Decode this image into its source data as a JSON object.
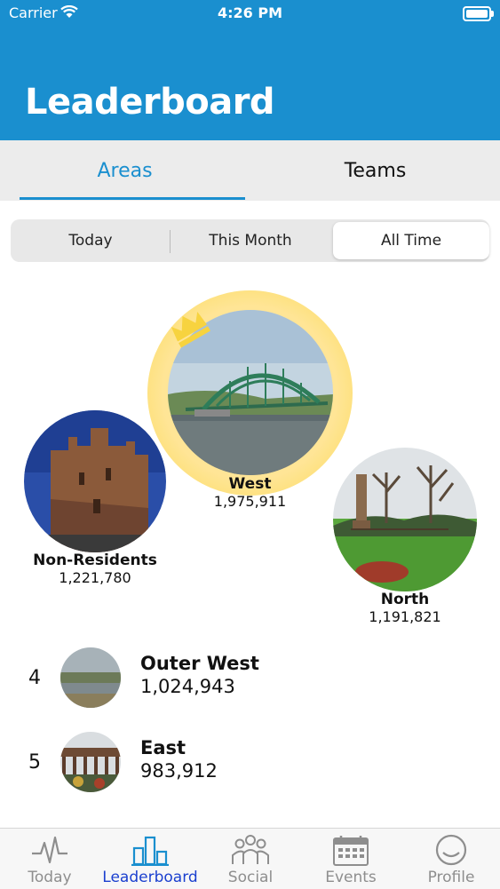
{
  "status_bar": {
    "carrier": "Carrier",
    "time": "4:26 PM"
  },
  "header": {
    "title": "Leaderboard"
  },
  "tabs": [
    {
      "label": "Areas",
      "active": true
    },
    {
      "label": "Teams",
      "active": false
    }
  ],
  "period_filter": {
    "options": [
      "Today",
      "This Month",
      "All Time"
    ],
    "selected": "All Time"
  },
  "podium": {
    "first": {
      "name": "West",
      "score": "1,975,911",
      "rank": 1
    },
    "second": {
      "name": "Non-Residents",
      "score": "1,221,780",
      "rank": 2
    },
    "third": {
      "name": "North",
      "score": "1,191,821",
      "rank": 3
    }
  },
  "rankings": [
    {
      "rank": "4",
      "name": "Outer West",
      "score": "1,024,943"
    },
    {
      "rank": "5",
      "name": "East",
      "score": "983,912"
    }
  ],
  "tab_bar": [
    {
      "label": "Today",
      "icon": "pulse-icon",
      "active": false
    },
    {
      "label": "Leaderboard",
      "icon": "bar-chart-icon",
      "active": true
    },
    {
      "label": "Social",
      "icon": "people-icon",
      "active": false
    },
    {
      "label": "Events",
      "icon": "calendar-icon",
      "active": false
    },
    {
      "label": "Profile",
      "icon": "smiley-icon",
      "active": false
    }
  ],
  "colors": {
    "brand": "#1a8fcf",
    "active_tab": "#1a3fcf",
    "gold": "#f9d94e"
  }
}
